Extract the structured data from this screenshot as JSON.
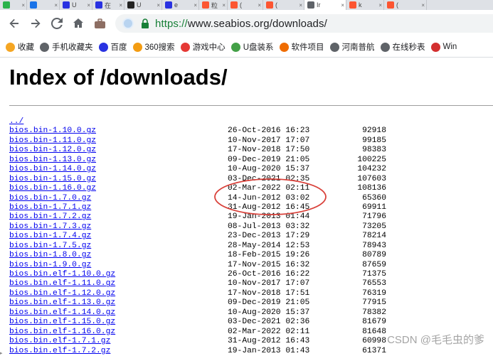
{
  "tabs": [
    {
      "label": "",
      "icon": "edge-icon",
      "color": "#2bb24c",
      "active": false
    },
    {
      "label": "",
      "icon": "blue-circle-icon",
      "color": "#1a73e8",
      "active": false
    },
    {
      "label": "U",
      "icon": "paw-icon",
      "color": "#2932e1",
      "active": false
    },
    {
      "label": "在",
      "icon": "paw-icon",
      "color": "#2932e1",
      "active": false
    },
    {
      "label": "U",
      "icon": "fs-icon",
      "color": "#222222",
      "active": false
    },
    {
      "label": "e",
      "icon": "paw-icon",
      "color": "#2932e1",
      "active": false
    },
    {
      "label": "粒",
      "icon": "csdn-icon",
      "color": "#fc5531",
      "active": false
    },
    {
      "label": "(",
      "icon": "csdn-icon",
      "color": "#fc5531",
      "active": false
    },
    {
      "label": "(",
      "icon": "csdn-icon",
      "color": "#fc5531",
      "active": false
    },
    {
      "label": "Ir",
      "icon": "globe-icon",
      "color": "#5f6368",
      "active": true
    },
    {
      "label": "k",
      "icon": "csdn-icon",
      "color": "#fc5531",
      "active": false
    },
    {
      "label": "(",
      "icon": "csdn-icon",
      "color": "#fc5531",
      "active": false
    }
  ],
  "address_bar": {
    "scheme": "https://",
    "host_path": "www.seabios.org/downloads/"
  },
  "bookmarks": [
    {
      "label": "收藏",
      "icon": "star-icon",
      "color": "#f5a623"
    },
    {
      "label": "手机收藏夹",
      "icon": "folder-icon",
      "color": "#5f6368"
    },
    {
      "label": "百度",
      "icon": "paw-icon",
      "color": "#2932e1"
    },
    {
      "label": "360搜索",
      "icon": "360-icon",
      "color": "#f39c12"
    },
    {
      "label": "游戏中心",
      "icon": "game-icon",
      "color": "#e53935"
    },
    {
      "label": "U盘装系",
      "icon": "usb-icon",
      "color": "#43a047"
    },
    {
      "label": "软件项目",
      "icon": "orange-icon",
      "color": "#ef6c00"
    },
    {
      "label": "河南普航",
      "icon": "globe-icon",
      "color": "#5f6368"
    },
    {
      "label": "在线秒表",
      "icon": "globe-icon",
      "color": "#5f6368"
    },
    {
      "label": "Win",
      "icon": "windows-icon",
      "color": "#d32f2f"
    }
  ],
  "page": {
    "title": "Index of /downloads/",
    "parent_link": "../",
    "files": [
      {
        "name": "bios.bin-1.10.0.gz",
        "date": "26-Oct-2016 16:23",
        "size": "92918"
      },
      {
        "name": "bios.bin-1.11.0.gz",
        "date": "10-Nov-2017 17:07",
        "size": "99185"
      },
      {
        "name": "bios.bin-1.12.0.gz",
        "date": "17-Nov-2018 17:50",
        "size": "98383"
      },
      {
        "name": "bios.bin-1.13.0.gz",
        "date": "09-Dec-2019 21:05",
        "size": "100225"
      },
      {
        "name": "bios.bin-1.14.0.gz",
        "date": "10-Aug-2020 15:37",
        "size": "104232"
      },
      {
        "name": "bios.bin-1.15.0.gz",
        "date": "03-Dec-2021 02:35",
        "size": "107603"
      },
      {
        "name": "bios.bin-1.16.0.gz",
        "date": "02-Mar-2022 02:11",
        "size": "108136"
      },
      {
        "name": "bios.bin-1.7.0.gz",
        "date": "14-Jun-2012 03:02",
        "size": "65360"
      },
      {
        "name": "bios.bin-1.7.1.gz",
        "date": "31-Aug-2012 16:45",
        "size": "69911"
      },
      {
        "name": "bios.bin-1.7.2.gz",
        "date": "19-Jan-2013 01:44",
        "size": "71796"
      },
      {
        "name": "bios.bin-1.7.3.gz",
        "date": "08-Jul-2013 03:32",
        "size": "73205"
      },
      {
        "name": "bios.bin-1.7.4.gz",
        "date": "23-Dec-2013 17:29",
        "size": "78214"
      },
      {
        "name": "bios.bin-1.7.5.gz",
        "date": "28-May-2014 12:53",
        "size": "78943"
      },
      {
        "name": "bios.bin-1.8.0.gz",
        "date": "18-Feb-2015 19:26",
        "size": "80789"
      },
      {
        "name": "bios.bin-1.9.0.gz",
        "date": "17-Nov-2015 16:32",
        "size": "87659"
      },
      {
        "name": "bios.bin.elf-1.10.0.gz",
        "date": "26-Oct-2016 16:22",
        "size": "71375"
      },
      {
        "name": "bios.bin.elf-1.11.0.gz",
        "date": "10-Nov-2017 17:07",
        "size": "76553"
      },
      {
        "name": "bios.bin.elf-1.12.0.gz",
        "date": "17-Nov-2018 17:51",
        "size": "76319"
      },
      {
        "name": "bios.bin.elf-1.13.0.gz",
        "date": "09-Dec-2019 21:05",
        "size": "77915"
      },
      {
        "name": "bios.bin.elf-1.14.0.gz",
        "date": "10-Aug-2020 15:37",
        "size": "78382"
      },
      {
        "name": "bios.bin.elf-1.15.0.gz",
        "date": "03-Dec-2021 02:36",
        "size": "81679"
      },
      {
        "name": "bios.bin.elf-1.16.0.gz",
        "date": "02-Mar-2022 02:11",
        "size": "81648"
      },
      {
        "name": "bios.bin.elf-1.7.1.gz",
        "date": "31-Aug-2012 16:43",
        "size": "60998"
      },
      {
        "name": "bios.bin.elf-1.7.2.gz",
        "date": "19-Jan-2013 01:43",
        "size": "61371"
      }
    ]
  },
  "annotation_color": "#d9413a",
  "watermark": "CSDN @毛毛虫的爹"
}
